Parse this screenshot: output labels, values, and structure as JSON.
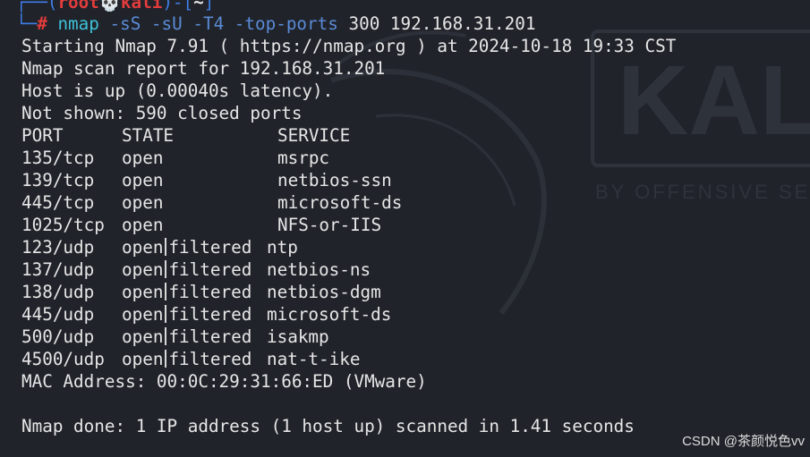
{
  "prompt": {
    "corner_top": "┌──(",
    "user": "root",
    "skull": "💀",
    "host": "kali",
    "close_paren": ")-[",
    "dir": "~",
    "close_bracket": "]",
    "corner_bottom": "└─",
    "hash": "#",
    "command": "nmap",
    "args": "-sS -sU -T4 -top-ports",
    "tail": "300 192.168.31.201"
  },
  "output": {
    "starting": "Starting Nmap 7.91 ( https://nmap.org ) at 2024-10-18 19:33 CST",
    "report": "Nmap scan report for 192.168.31.201",
    "host_up": "Host is up (0.00040s latency).",
    "not_shown": "Not shown: 590 closed ports",
    "header": {
      "port": "PORT",
      "state": "STATE",
      "service": "SERVICE"
    },
    "rows": [
      {
        "port": "135/tcp",
        "state": "open",
        "filtered": "",
        "service": "msrpc"
      },
      {
        "port": "139/tcp",
        "state": "open",
        "filtered": "",
        "service": "netbios-ssn"
      },
      {
        "port": "445/tcp",
        "state": "open",
        "filtered": "",
        "service": "microsoft-ds"
      },
      {
        "port": "1025/tcp",
        "state": "open",
        "filtered": "",
        "service": "NFS-or-IIS"
      },
      {
        "port": "123/udp",
        "state": "open",
        "filtered": "filtered",
        "service": "ntp"
      },
      {
        "port": "137/udp",
        "state": "open",
        "filtered": "filtered",
        "service": "netbios-ns"
      },
      {
        "port": "138/udp",
        "state": "open",
        "filtered": "filtered",
        "service": "netbios-dgm"
      },
      {
        "port": "445/udp",
        "state": "open",
        "filtered": "filtered",
        "service": "microsoft-ds"
      },
      {
        "port": "500/udp",
        "state": "open",
        "filtered": "filtered",
        "service": "isakmp"
      },
      {
        "port": "4500/udp",
        "state": "open",
        "filtered": "filtered",
        "service": "nat-t-ike"
      }
    ],
    "mac": "MAC Address: 00:0C:29:31:66:ED (VMware)",
    "done": "Nmap done: 1 IP address (1 host up) scanned in 1.41 seconds"
  },
  "watermark": {
    "brand": "KAL",
    "tagline": "BY OFFENSIVE SE"
  },
  "badge": "CSDN @茶颜悦色vv",
  "colors": {
    "background": "#20232a",
    "text": "#e6e6e6",
    "prompt_red": "#e23c3c",
    "prompt_blue": "#3f7ee8",
    "command_cyan": "#3fc0d8"
  }
}
